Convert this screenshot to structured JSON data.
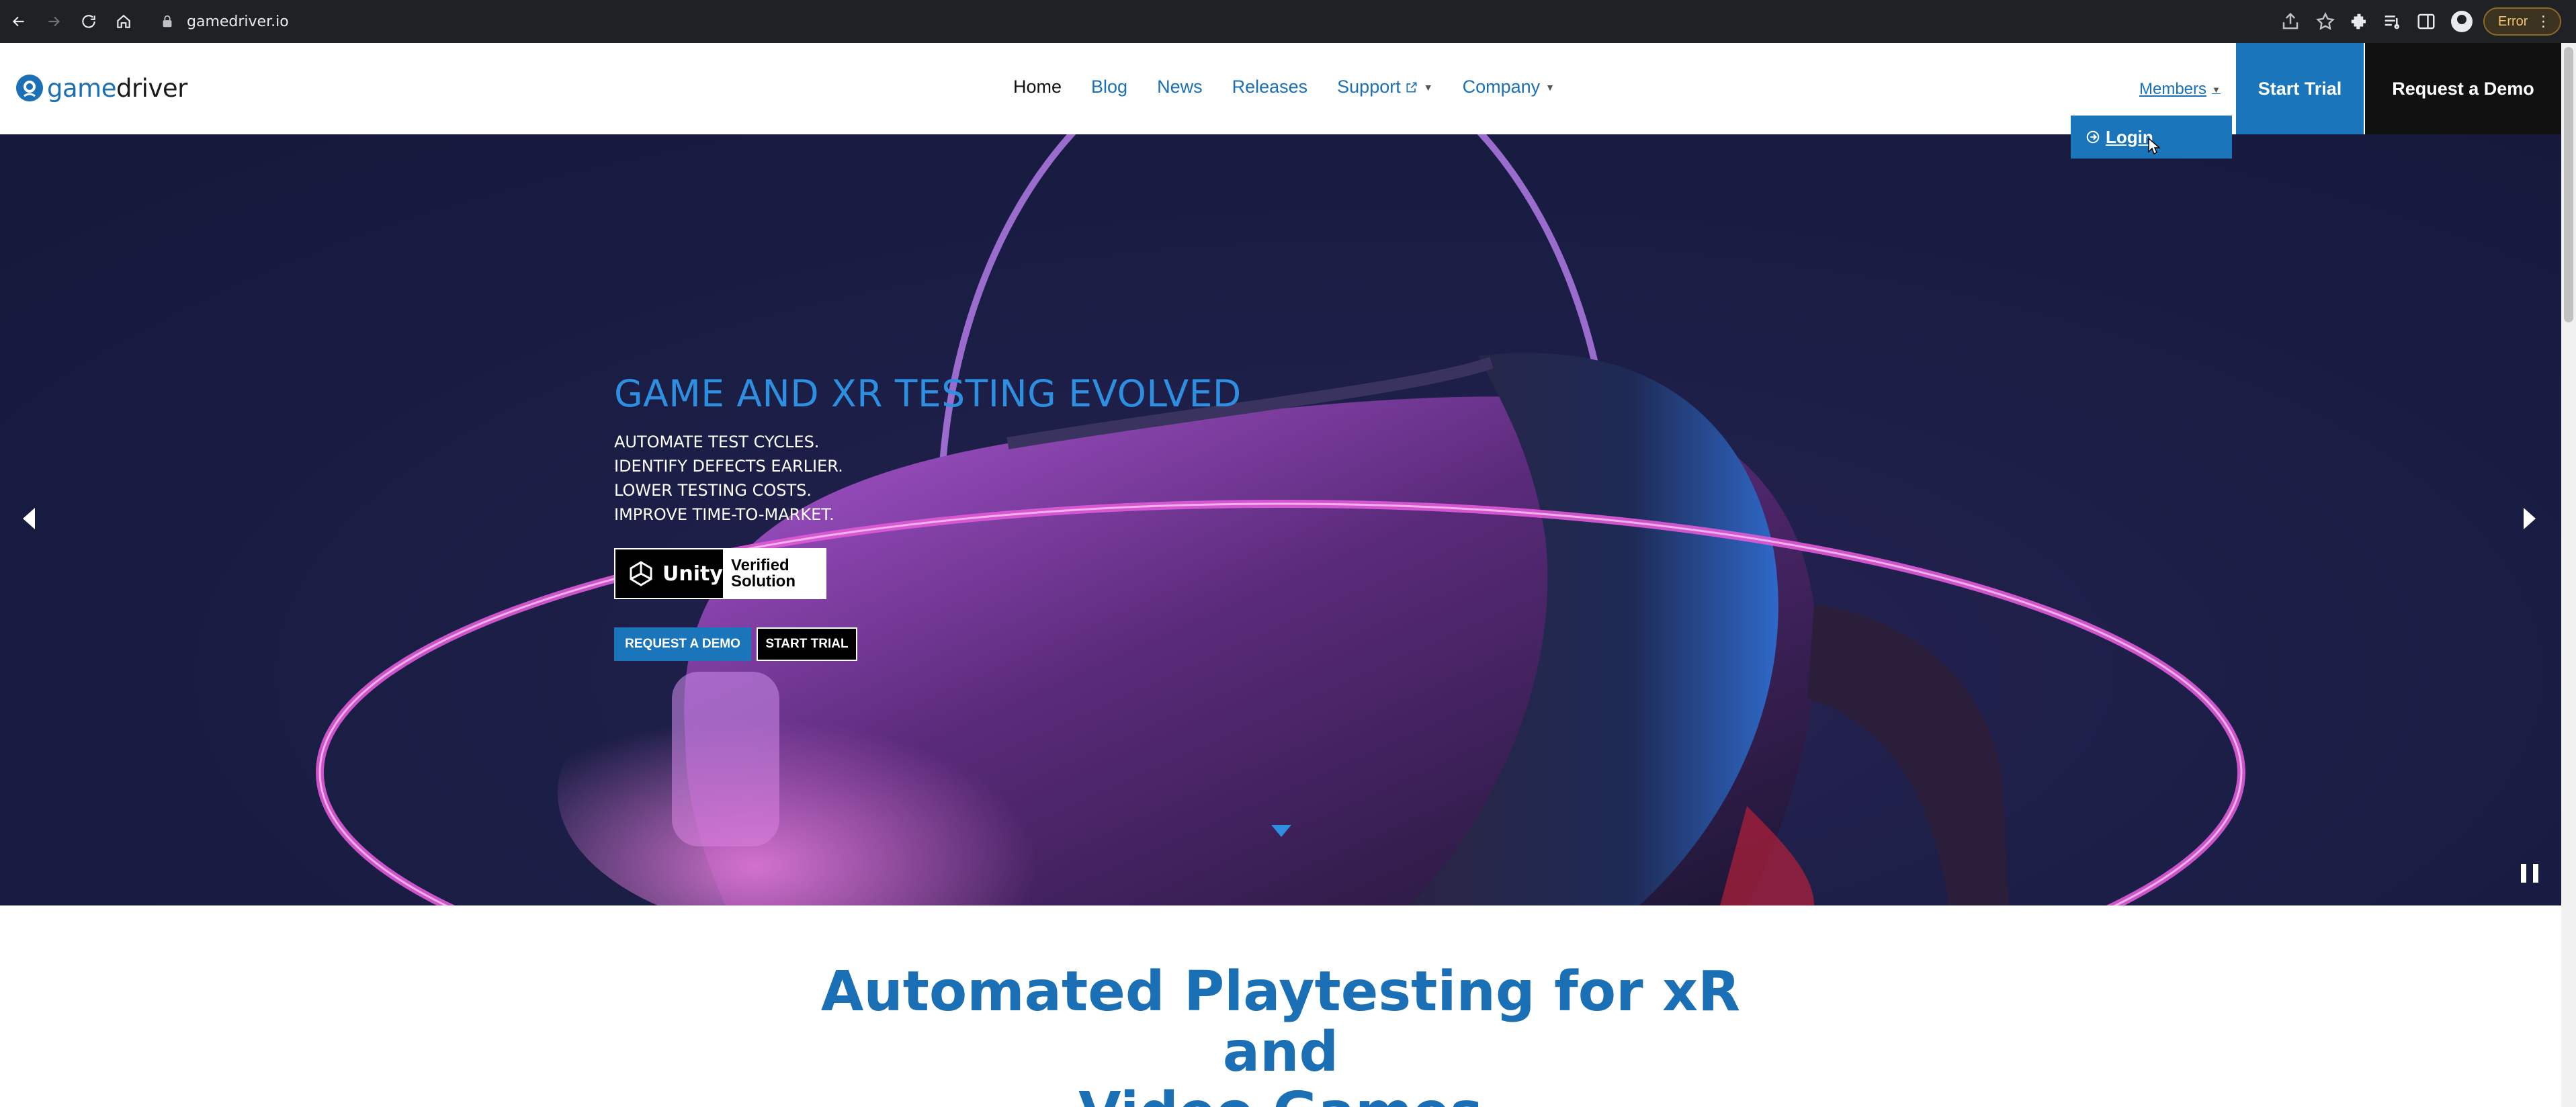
{
  "browser": {
    "url": "gamedriver.io",
    "error_label": "Error"
  },
  "header": {
    "logo_word_a": "game",
    "logo_word_b": "driver",
    "nav": [
      {
        "label": "Home"
      },
      {
        "label": "Blog"
      },
      {
        "label": "News"
      },
      {
        "label": "Releases"
      },
      {
        "label": "Support"
      },
      {
        "label": "Company"
      }
    ],
    "members_label": "Members",
    "start_trial_label": "Start Trial",
    "request_demo_label": "Request a Demo",
    "login_label": "Login"
  },
  "hero": {
    "title": "GAME AND XR TESTING EVOLVED",
    "lines": [
      "AUTOMATE TEST CYCLES.",
      "IDENTIFY DEFECTS EARLIER.",
      "LOWER TESTING COSTS.",
      "IMPROVE TIME-TO-MARKET."
    ],
    "badge_left": "Unity",
    "badge_right_1": "Verified",
    "badge_right_2": "Solution",
    "btn_demo": "REQUEST A DEMO",
    "btn_trial": "START TRIAL"
  },
  "section": {
    "heading_line1": "Automated Playtesting for xR and",
    "heading_line2": "Video Games"
  },
  "colors": {
    "brand_blue": "#1b75bb",
    "hero_title": "#2e8fe0",
    "chrome_bg": "#202124"
  }
}
